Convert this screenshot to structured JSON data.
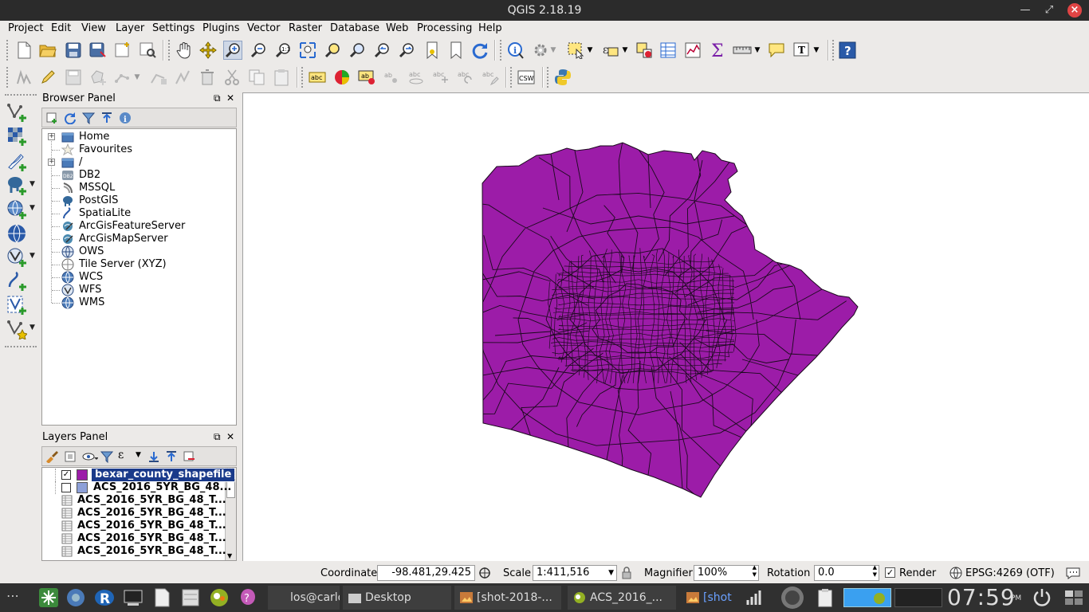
{
  "window": {
    "title": "QGIS 2.18.19",
    "controls": [
      "minimize",
      "maximize",
      "close"
    ]
  },
  "menubar": {
    "items": [
      "Project",
      "Edit",
      "View",
      "Layer",
      "Settings",
      "Plugins",
      "Vector",
      "Raster",
      "Database",
      "Web",
      "Processing",
      "Help"
    ]
  },
  "browser_panel": {
    "title": "Browser Panel",
    "items": [
      {
        "label": "Home",
        "icon": "folder-icon",
        "expandable": true
      },
      {
        "label": "Favourites",
        "icon": "star-icon",
        "expandable": false
      },
      {
        "label": "/",
        "icon": "folder-icon",
        "expandable": true
      },
      {
        "label": "DB2",
        "icon": "db2-icon",
        "expandable": false
      },
      {
        "label": "MSSQL",
        "icon": "mssql-icon",
        "expandable": false
      },
      {
        "label": "PostGIS",
        "icon": "postgis-icon",
        "expandable": false
      },
      {
        "label": "SpatiaLite",
        "icon": "spatialite-icon",
        "expandable": false
      },
      {
        "label": "ArcGisFeatureServer",
        "icon": "arcgis-icon",
        "expandable": false
      },
      {
        "label": "ArcGisMapServer",
        "icon": "arcgis-icon",
        "expandable": false
      },
      {
        "label": "OWS",
        "icon": "globe-icon",
        "expandable": false
      },
      {
        "label": "Tile Server (XYZ)",
        "icon": "tile-server-icon",
        "expandable": false
      },
      {
        "label": "WCS",
        "icon": "globe-icon",
        "expandable": false
      },
      {
        "label": "WFS",
        "icon": "wfs-icon",
        "expandable": false
      },
      {
        "label": "WMS",
        "icon": "globe-icon",
        "expandable": false
      }
    ]
  },
  "layers_panel": {
    "title": "Layers Panel",
    "layers": [
      {
        "label": "bexar_county_shapefile",
        "checked": true,
        "selected": true,
        "color": "#9c1ca8",
        "type": "polygon"
      },
      {
        "label": "ACS_2016_5YR_BG_48...",
        "checked": false,
        "selected": false,
        "color": "#8da0d8",
        "type": "polygon"
      },
      {
        "label": "ACS_2016_5YR_BG_48_T...",
        "type": "table"
      },
      {
        "label": "ACS_2016_5YR_BG_48_T...",
        "type": "table"
      },
      {
        "label": "ACS_2016_5YR_BG_48_T...",
        "type": "table"
      },
      {
        "label": "ACS_2016_5YR_BG_48_T...",
        "type": "table"
      },
      {
        "label": "ACS_2016_5YR_BG_48_T...",
        "type": "table"
      }
    ]
  },
  "map": {
    "fill_color": "#9c1ca8",
    "stroke_color": "#1a0a1c"
  },
  "statusbar": {
    "coordinate_label": "Coordinate",
    "coordinate_value": "-98.481,29.425",
    "scale_label": "Scale",
    "scale_value": "1:411,516",
    "magnifier_label": "Magnifier",
    "magnifier_value": "100%",
    "rotation_label": "Rotation",
    "rotation_value": "0.0",
    "render_label": "Render",
    "render_checked": true,
    "crs_label": "EPSG:4269 (OTF)"
  },
  "taskbar": {
    "tasks": [
      {
        "label": "los@carlo...",
        "icon": "terminal-icon"
      },
      {
        "label": "Desktop",
        "icon": "folder-icon"
      },
      {
        "label": "[shot-2018-...",
        "icon": "image-icon"
      },
      {
        "label": "ACS_2016_...",
        "icon": "qgis-icon"
      },
      {
        "label": "[shot",
        "icon": "image-icon"
      }
    ],
    "clock": "07:59",
    "ampm": "PM"
  }
}
